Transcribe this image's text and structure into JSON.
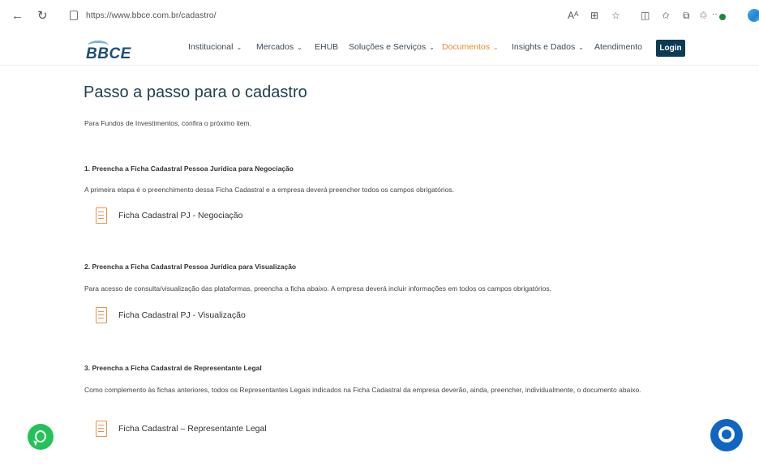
{
  "browser": {
    "url": "https://www.bbce.com.br/cadastro/",
    "back_icon": "←",
    "reload_icon": "↻",
    "toolbar_icons": [
      "Aᴬ",
      "⊞",
      "☆",
      "◫",
      "✩",
      "⧉",
      "♲"
    ],
    "extension_text": "··"
  },
  "header": {
    "logo_text": "BBCE",
    "menu": [
      {
        "label": "Institucional",
        "chevron": "⌄"
      },
      {
        "label": "Mercados",
        "chevron": "⌄"
      },
      {
        "label": "EHUB",
        "chevron": ""
      },
      {
        "label": "Soluções e Serviços",
        "chevron": "⌄"
      },
      {
        "label": "Documentos",
        "chevron": "⌄",
        "active": true
      },
      {
        "label": "Insights e Dados",
        "chevron": "⌄"
      },
      {
        "label": "Atendimento",
        "chevron": ""
      }
    ],
    "login_label": "Login"
  },
  "content": {
    "title": "Passo a passo para o cadastro",
    "intro": "Para Fundos de Investimentos, confira o próximo item.",
    "steps": [
      {
        "title": "1. Preencha a Ficha Cadastral Pessoa Jurídica para Negociação",
        "description": "A primeira etapa é o preenchimento dessa Ficha Cadastral e a empresa deverá preencher todos os campos obrigatórios.",
        "link_label": "Ficha Cadastral PJ - Negociação"
      },
      {
        "title": "2. Preencha a Ficha Cadastral Pessoa Jurídica para Visualização",
        "description": "Para acesso de consulta/visualização das plataformas, preencha a ficha abaixo. A empresa deverá incluir informações em todos os campos obrigatórios.",
        "link_label": "Ficha Cadastral PJ - Visualização"
      },
      {
        "title": "3. Preencha a Ficha Cadastral de Representante Legal",
        "description": "Como complemento às fichas anteriores, todos os Representantes Legais indicados na Ficha Cadastral da empresa deverão, ainda, preencher, individualmente, o documento abaixo.",
        "link_label": "Ficha Cadastral – Representante Legal"
      }
    ]
  },
  "colors": {
    "accent": "#e88a2d",
    "brand_dark": "#0d3b55",
    "whatsapp": "#25c15a",
    "chat": "#0e66c2"
  }
}
